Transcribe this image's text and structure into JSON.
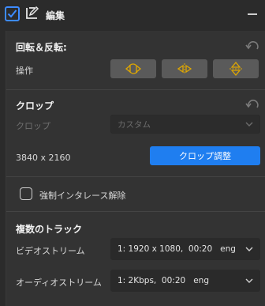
{
  "header": {
    "title": "編集",
    "checked": true
  },
  "rotate": {
    "title": "回転＆反転:",
    "operation_label": "操作",
    "buttons": [
      "rotate-icon",
      "flip-horizontal-icon",
      "flip-vertical-icon"
    ]
  },
  "crop": {
    "title": "クロップ",
    "crop_label": "クロップ",
    "crop_value": "カスタム",
    "resolution": "3840 x 2160",
    "adjust_button": "クロップ調整"
  },
  "deinterlace": {
    "label": "強制インタレース解除",
    "checked": false
  },
  "tracks": {
    "title": "複数のトラック",
    "video_label": "ビデオストリーム",
    "video_value": "1: 1920 x 1080,  00:20   eng",
    "audio_label": "オーディオストリーム",
    "audio_value": "1: 2Kbps,  00:20   eng"
  },
  "colors": {
    "accent": "#1f7ef0",
    "checkbox": "#3d8bff",
    "icon_gold": "#e0a800"
  }
}
